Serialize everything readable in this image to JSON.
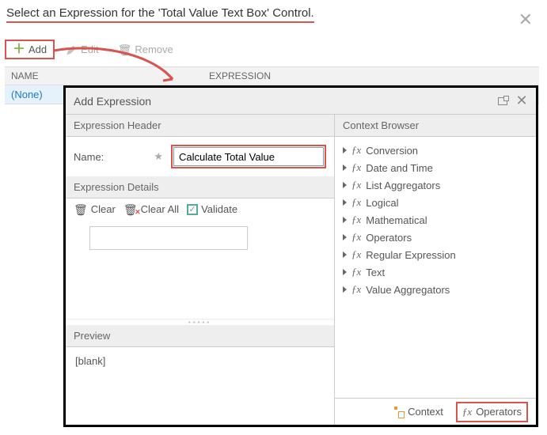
{
  "back": {
    "title": "Select an Expression for the 'Total Value Text Box' Control.",
    "add": "Add",
    "edit": "Edit",
    "remove": "Remove",
    "col_name": "NAME",
    "col_expr": "EXPRESSION",
    "row_none": "(None)"
  },
  "dialog": {
    "title": "Add Expression",
    "header_expr": "Expression Header",
    "header_ctx": "Context Browser",
    "name_label": "Name:",
    "name_value": "Calculate Total Value",
    "details_header": "Expression Details",
    "clear": "Clear",
    "clear_all": "Clear All",
    "validate": "Validate",
    "preview_header": "Preview",
    "preview_value": "[blank]",
    "ctx_items": [
      "Conversion",
      "Date and Time",
      "List Aggregators",
      "Logical",
      "Mathematical",
      "Operators",
      "Regular Expression",
      "Text",
      "Value Aggregators"
    ],
    "tab_context": "Context",
    "tab_operators": "Operators"
  }
}
